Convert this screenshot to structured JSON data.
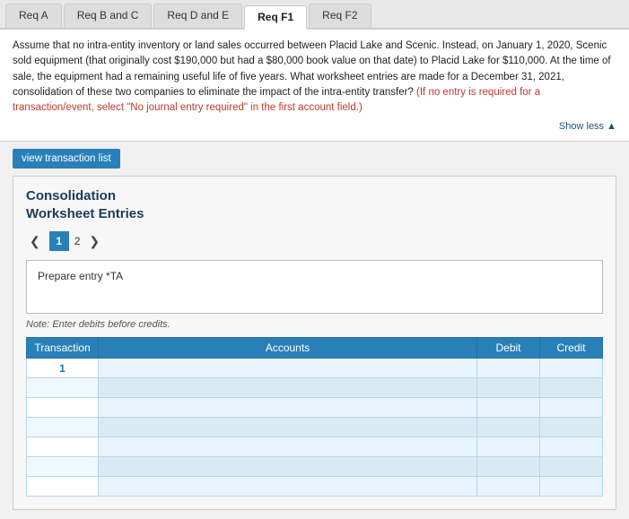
{
  "tabs": [
    {
      "label": "Req A",
      "active": false
    },
    {
      "label": "Req B and C",
      "active": false
    },
    {
      "label": "Req D and E",
      "active": false
    },
    {
      "label": "Req F1",
      "active": true
    },
    {
      "label": "Req F2",
      "active": false
    }
  ],
  "instruction": {
    "text": "Assume that no intra-entity inventory or land sales occurred between Placid Lake and Scenic. Instead, on January 1, 2020, Scenic sold equipment (that originally cost $190,000 but had a $80,000 book value on that date) to Placid Lake for $110,000. At the time of sale, the equipment had a remaining useful life of five years. What worksheet entries are made for a December 31, 2021, consolidation of these two companies to eliminate the impact of the intra-entity transfer?",
    "highlight": "(If no entry is required for a transaction/event, select \"No journal entry required\" in the first account field.)",
    "show_less": "Show less ▲"
  },
  "btn_view_transaction": "view transaction list",
  "worksheet": {
    "title_line1": "Consolidation",
    "title_line2": "Worksheet Entries",
    "pages": [
      {
        "num": 1,
        "active": true
      },
      {
        "num": 2,
        "active": false
      }
    ],
    "prev_arrow": "❮",
    "next_arrow": "❯",
    "prepare_entry_label": "Prepare entry *TA",
    "note": "Note: Enter debits before credits.",
    "table": {
      "headers": [
        "Transaction",
        "Accounts",
        "Debit",
        "Credit"
      ],
      "rows": [
        {
          "transaction": "1",
          "account": "",
          "debit": "",
          "credit": ""
        },
        {
          "transaction": "",
          "account": "",
          "debit": "",
          "credit": ""
        },
        {
          "transaction": "",
          "account": "",
          "debit": "",
          "credit": ""
        },
        {
          "transaction": "",
          "account": "",
          "debit": "",
          "credit": ""
        },
        {
          "transaction": "",
          "account": "",
          "debit": "",
          "credit": ""
        },
        {
          "transaction": "",
          "account": "",
          "debit": "",
          "credit": ""
        },
        {
          "transaction": "",
          "account": "",
          "debit": "",
          "credit": ""
        }
      ]
    }
  },
  "colors": {
    "tab_active_bg": "#ffffff",
    "tab_inactive_bg": "#dddddd",
    "header_blue": "#2980b9",
    "title_blue": "#1a3a5c"
  }
}
